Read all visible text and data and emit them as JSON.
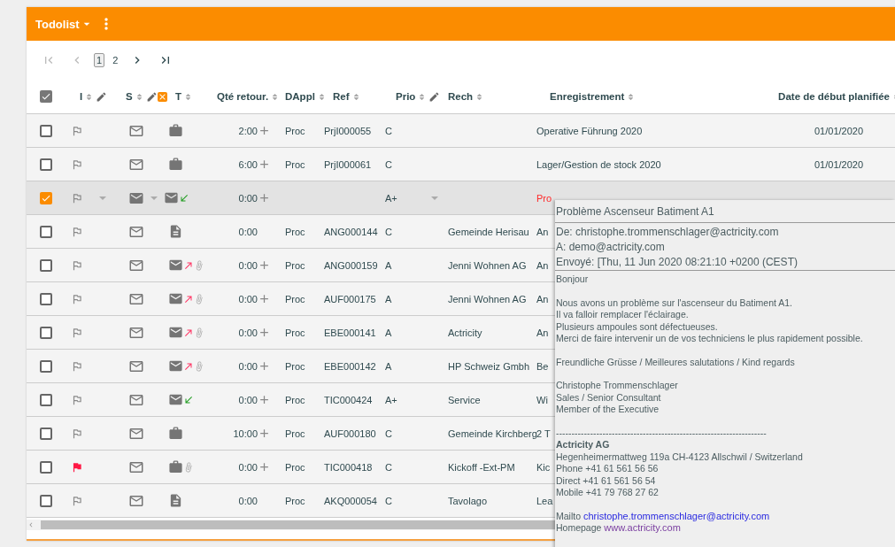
{
  "toolbar": {
    "title": "Todolist"
  },
  "pager": {
    "pages": [
      {
        "label": "1",
        "selected": true
      },
      {
        "label": "2",
        "selected": false
      }
    ]
  },
  "table": {
    "header_checked": true,
    "columns": [
      {
        "label": "I",
        "editable": true,
        "clearable": false
      },
      {
        "label": "S",
        "editable": true,
        "clearable": true
      },
      {
        "label": "T",
        "editable": false,
        "clearable": false
      },
      {
        "label": "Qté retour.",
        "editable": false,
        "clearable": false
      },
      {
        "label": "DAppl",
        "editable": false,
        "clearable": false
      },
      {
        "label": "Ref",
        "editable": false,
        "clearable": false
      },
      {
        "label": "Prio",
        "editable": true,
        "clearable": false
      },
      {
        "label": "Rech",
        "editable": false,
        "clearable": false
      },
      {
        "label": "Enregistrement",
        "editable": false,
        "clearable": false
      },
      {
        "label": "Date de début planifiée",
        "editable": false,
        "clearable": false
      }
    ],
    "rows": [
      {
        "selected": false,
        "flagged": false,
        "kind": "briefcase",
        "attachment": false,
        "qty": "2:00",
        "addable": true,
        "dappl": "Proc",
        "ref": "PrjI000055",
        "prio": "C",
        "rech": "",
        "registration": "Operative Führung 2020",
        "alert": false,
        "date": "01/01/2020"
      },
      {
        "selected": false,
        "flagged": false,
        "kind": "briefcase",
        "attachment": false,
        "qty": "6:00",
        "addable": true,
        "dappl": "Proc",
        "ref": "PrjI000061",
        "prio": "C",
        "rech": "",
        "registration": "Lager/Gestion de stock 2020",
        "alert": false,
        "date": "01/01/2020"
      },
      {
        "selected": true,
        "flagged": false,
        "kind": "mail-in",
        "attachment": false,
        "qty": "0:00",
        "addable": true,
        "dappl": "",
        "ref": "",
        "prio": "A+",
        "rech": "",
        "registration": "Pro",
        "alert": true,
        "date": ""
      },
      {
        "selected": false,
        "flagged": false,
        "kind": "document",
        "attachment": false,
        "qty": "0:00",
        "addable": false,
        "dappl": "Proc",
        "ref": "ANG000144",
        "prio": "C",
        "rech": "Gemeinde Herisau",
        "registration": "An",
        "alert": false,
        "date": ""
      },
      {
        "selected": false,
        "flagged": false,
        "kind": "mail-out",
        "attachment": true,
        "qty": "0:00",
        "addable": true,
        "dappl": "Proc",
        "ref": "ANG000159",
        "prio": "A",
        "rech": "Jenni Wohnen AG",
        "registration": "An",
        "alert": false,
        "date": ""
      },
      {
        "selected": false,
        "flagged": false,
        "kind": "mail-out",
        "attachment": true,
        "qty": "0:00",
        "addable": true,
        "dappl": "Proc",
        "ref": "AUF000175",
        "prio": "A",
        "rech": "Jenni Wohnen AG",
        "registration": "An",
        "alert": false,
        "date": ""
      },
      {
        "selected": false,
        "flagged": false,
        "kind": "mail-out",
        "attachment": true,
        "qty": "0:00",
        "addable": true,
        "dappl": "Proc",
        "ref": "EBE000141",
        "prio": "A",
        "rech": "Actricity",
        "registration": "An",
        "alert": false,
        "date": ""
      },
      {
        "selected": false,
        "flagged": false,
        "kind": "mail-out",
        "attachment": true,
        "qty": "0:00",
        "addable": true,
        "dappl": "Proc",
        "ref": "EBE000142",
        "prio": "A",
        "rech": "HP Schweiz Gmbh",
        "registration": "Be",
        "alert": false,
        "date": ""
      },
      {
        "selected": false,
        "flagged": false,
        "kind": "mail-in",
        "attachment": false,
        "qty": "0:00",
        "addable": true,
        "dappl": "Proc",
        "ref": "TIC000424",
        "prio": "A+",
        "rech": "Service",
        "registration": "Wi",
        "alert": false,
        "date": ""
      },
      {
        "selected": false,
        "flagged": false,
        "kind": "briefcase",
        "attachment": false,
        "qty": "10:00",
        "addable": true,
        "dappl": "Proc",
        "ref": "AUF000180",
        "prio": "C",
        "rech": "Gemeinde Kirchberg",
        "registration": "2 T",
        "alert": false,
        "date": ""
      },
      {
        "selected": false,
        "flagged": true,
        "kind": "briefcase",
        "attachment": true,
        "qty": "0:00",
        "addable": true,
        "dappl": "Proc",
        "ref": "TIC000418",
        "prio": "C",
        "rech": "Kickoff -Ext-PM",
        "registration": "Kic",
        "alert": false,
        "date": ""
      },
      {
        "selected": false,
        "flagged": false,
        "kind": "document",
        "attachment": false,
        "qty": "0:00",
        "addable": false,
        "dappl": "Proc",
        "ref": "AKQ000054",
        "prio": "C",
        "rech": "Tavolago",
        "registration": "Lea",
        "alert": false,
        "date": ""
      }
    ]
  },
  "mail_preview": {
    "subject": "Problème Ascenseur Batiment A1",
    "headers": [
      "De: christophe.trommenschlager@actricity.com",
      "A: demo@actricity.com",
      "Envoyé: [Thu, 11 Jun 2020 08:21:10 +0200 (CEST)"
    ],
    "paragraphs": [
      [
        {
          "kind": "text",
          "text": "Bonjour"
        }
      ],
      [
        {
          "kind": "text",
          "text": "Nous avons un problème sur l'ascenseur du Batiment A1."
        },
        {
          "kind": "text",
          "text": "Il va falloir remplacer l'éclairage."
        },
        {
          "kind": "text",
          "text": "Plusieurs ampoules sont défectueuses."
        },
        {
          "kind": "text",
          "text": "Merci de faire intervenir un de vos techniciens le plus rapidement possible."
        }
      ],
      [
        {
          "kind": "text",
          "text": "Freundliche Grüsse / Meilleures salutations / Kind regards"
        }
      ],
      [
        {
          "kind": "text",
          "text": "Christophe Trommenschlager"
        },
        {
          "kind": "text",
          "text": "Sales / Senior Consultant"
        },
        {
          "kind": "text",
          "text": "Member of the Executive"
        }
      ],
      [
        {
          "kind": "text",
          "text": "--------------------------------------------------------------------"
        },
        {
          "kind": "heading",
          "text": "Actricity AG"
        },
        {
          "kind": "text",
          "text": "Hegenheimermattweg 119a CH-4123 Allschwil / Switzerland"
        },
        {
          "kind": "text",
          "text": "Phone +41 61 561 56 56"
        },
        {
          "kind": "text",
          "text": "Direct +41 61 561 56 54"
        },
        {
          "kind": "text",
          "text": "Mobile +41 79 768 27 62"
        }
      ],
      [
        {
          "kind": "link",
          "text": "Mailto",
          "link": "christophe.trommenschlager@actricity.com",
          "visited": false
        },
        {
          "kind": "link",
          "text": "Homepage",
          "link": "www.actricity.com",
          "visited": true
        }
      ]
    ]
  }
}
